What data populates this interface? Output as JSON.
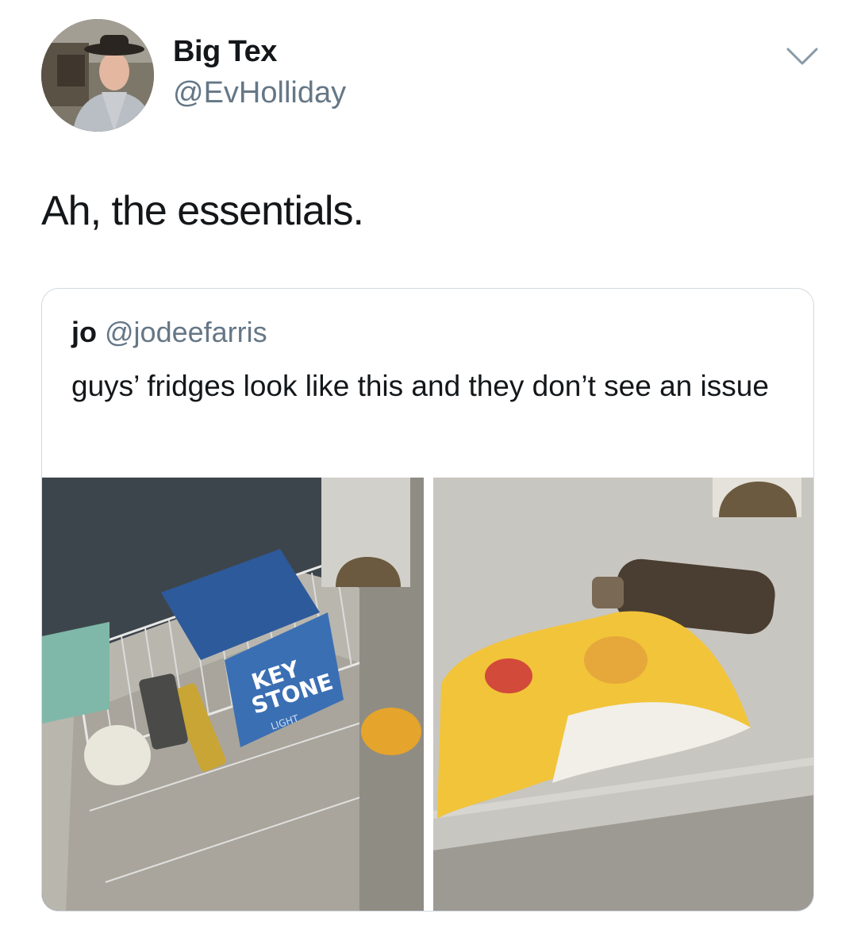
{
  "tweet": {
    "author": {
      "display_name": "Big Tex",
      "handle": "@EvHolliday"
    },
    "text": "Ah, the essentials.",
    "menu_icon": "chevron-down-icon"
  },
  "quoted_tweet": {
    "author": {
      "display_name": "jo",
      "handle": "@jodeefarris"
    },
    "text": "guys’ fridges look like this and they don’t see an issue",
    "photos": [
      {
        "description_icon": "fridge-photo",
        "printed_text": [
          "KEY",
          "STONE",
          "LIGHT"
        ]
      },
      {
        "description_icon": "freezer-photo",
        "printed_text": []
      }
    ]
  }
}
